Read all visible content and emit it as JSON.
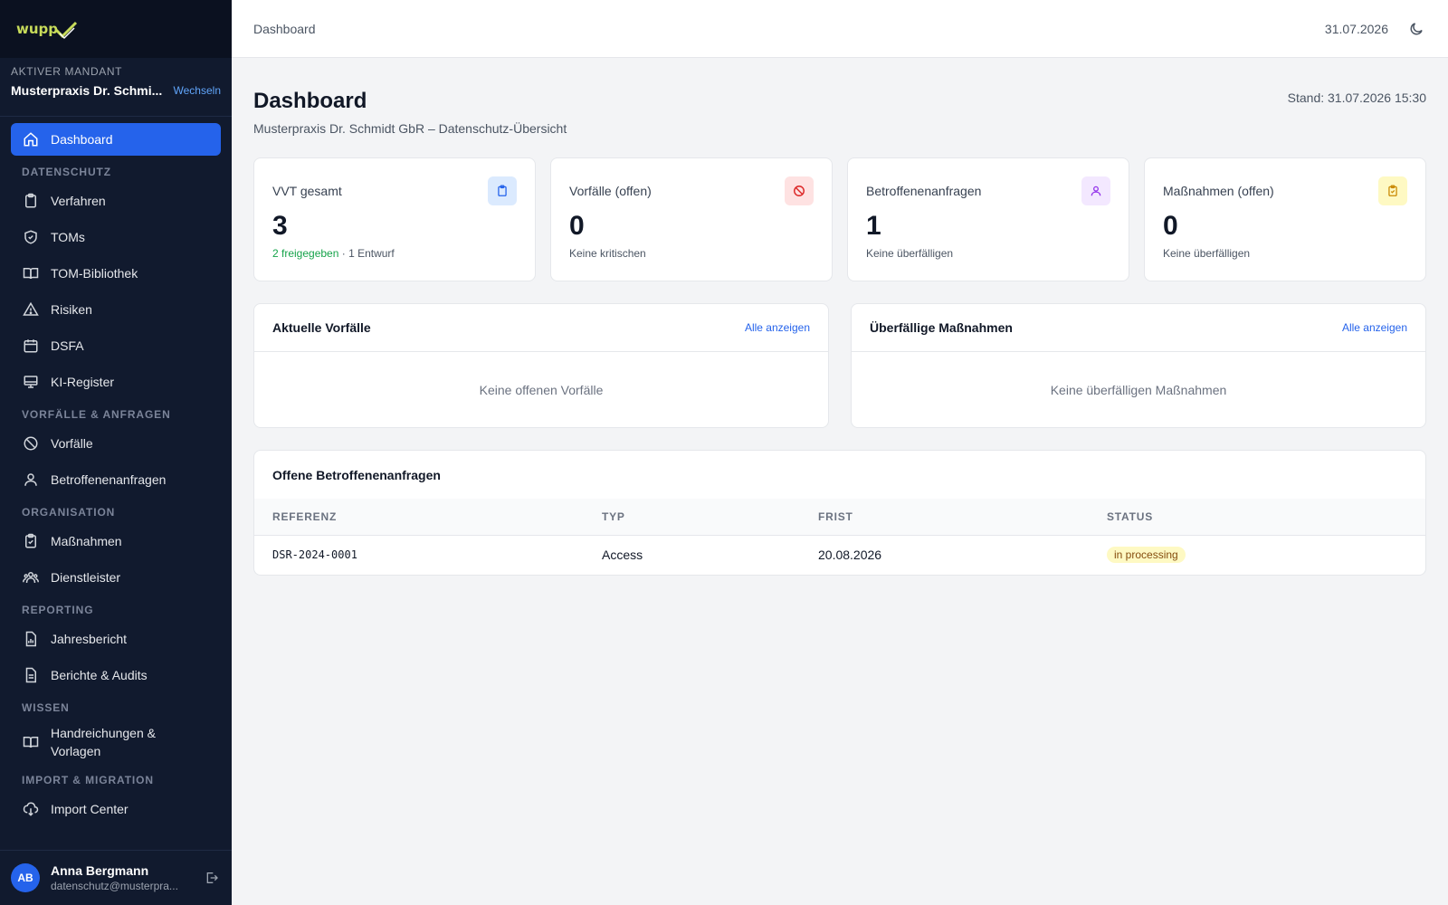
{
  "app": {
    "logo_text": "wupp"
  },
  "mandant": {
    "label": "Aktiver Mandant",
    "name": "Musterpraxis Dr. Schmi...",
    "switch_label": "Wechseln"
  },
  "nav": {
    "dashboard": "Dashboard",
    "section_datenschutz": "Datenschutz",
    "verfahren": "Verfahren",
    "toms": "TOMs",
    "tom_bibliothek": "TOM-Bibliothek",
    "risiken": "Risiken",
    "dsfa": "DSFA",
    "ki_register": "KI-Register",
    "section_vorfaelle": "Vorfälle & Anfragen",
    "vorfaelle": "Vorfälle",
    "betroffenenanfragen": "Betroffenenanfragen",
    "section_organisation": "Organisation",
    "massnahmen": "Maßnahmen",
    "dienstleister": "Dienstleister",
    "section_reporting": "Reporting",
    "jahresbericht": "Jahresbericht",
    "berichte": "Berichte & Audits",
    "section_wissen": "Wissen",
    "handreichungen_1": "Handreichungen &",
    "handreichungen_2": "Vorlagen",
    "section_import": "Import & Migration",
    "import_center": "Import Center"
  },
  "user": {
    "initials": "AB",
    "name": "Anna Bergmann",
    "email": "datenschutz@musterpra..."
  },
  "topbar": {
    "breadcrumb": "Dashboard",
    "date": "31.07.2026"
  },
  "header": {
    "title": "Dashboard",
    "subtitle": "Musterpraxis Dr. Schmidt GbR – Datenschutz-Übersicht",
    "stand": "Stand: 31.07.2026 15:30"
  },
  "kpis": [
    {
      "label": "VVT gesamt",
      "value": "3",
      "note_green": "2 freigegeben",
      "note": " · 1 Entwurf",
      "icon": "clipboard-icon",
      "color": "#2563eb",
      "bg": "#dbeafe"
    },
    {
      "label": "Vorfälle (offen)",
      "value": "0",
      "note_green": "",
      "note": "Keine kritischen",
      "icon": "ban-icon",
      "color": "#dc2626",
      "bg": "#fee2e2"
    },
    {
      "label": "Betroffenenanfragen",
      "value": "1",
      "note_green": "",
      "note": "Keine überfälligen",
      "icon": "user-icon",
      "color": "#9333ea",
      "bg": "#f3e8ff"
    },
    {
      "label": "Maßnahmen (offen)",
      "value": "0",
      "note_green": "",
      "note": "Keine überfälligen",
      "icon": "clipboard-check-icon",
      "color": "#ca8a04",
      "bg": "#fef9c3"
    }
  ],
  "panels": {
    "vorfaelle": {
      "title": "Aktuelle Vorfälle",
      "link": "Alle anzeigen",
      "empty": "Keine offenen Vorfälle"
    },
    "massnahmen": {
      "title": "Überfällige Maßnahmen",
      "link": "Alle anzeigen",
      "empty": "Keine überfälligen Maßnahmen"
    }
  },
  "requests": {
    "title": "Offene Betroffenenanfragen",
    "columns": [
      "Referenz",
      "Typ",
      "Frist",
      "Status"
    ],
    "rows": [
      {
        "ref": "DSR-2024-0001",
        "typ": "Access",
        "frist": "20.08.2026",
        "status": "in processing"
      }
    ]
  }
}
